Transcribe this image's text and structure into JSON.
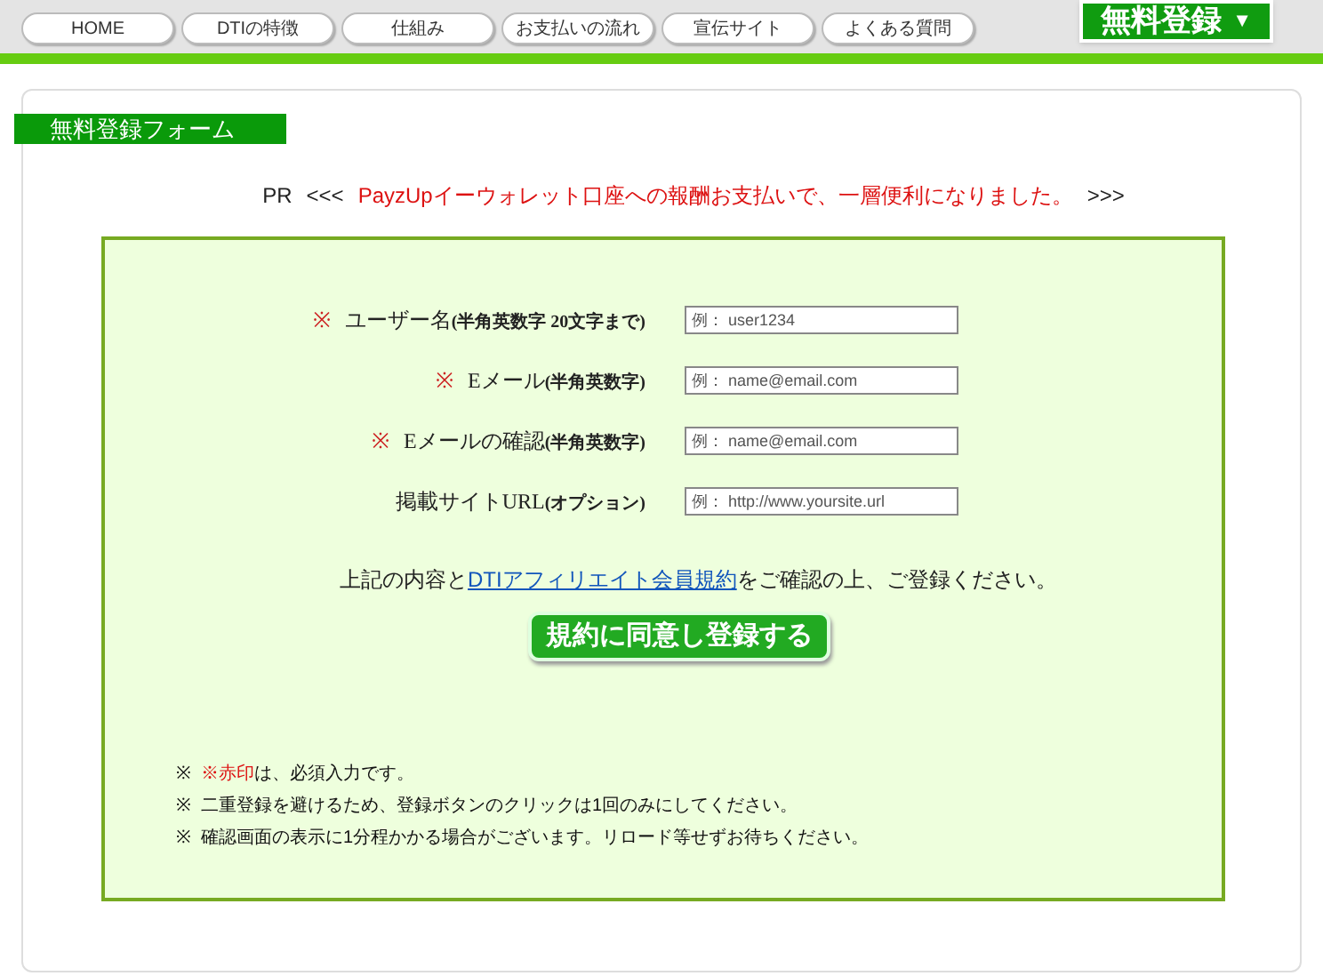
{
  "nav": {
    "items": [
      {
        "label": "HOME"
      },
      {
        "label": "DTIの特徴"
      },
      {
        "label": "仕組み"
      },
      {
        "label": "お支払いの流れ"
      },
      {
        "label": "宣伝サイト"
      },
      {
        "label": "よくある質問"
      }
    ],
    "signup_button": {
      "label": "無料登録",
      "caret": "▼"
    }
  },
  "section_title": "無料登録フォーム",
  "pr": {
    "label": "PR",
    "open": "<<<",
    "text": "PayzUpイーウォレット口座への報酬お支払いで、一層便利になりました。",
    "close": ">>>"
  },
  "fields": [
    {
      "mark": "※",
      "label": "ユーザー名**(半角英数字 20文字まで)**",
      "placeholder": "例： user1234"
    },
    {
      "mark": "※",
      "label": "Eメール**(半角英数字)**",
      "placeholder": "例： name@email.com"
    },
    {
      "mark": "※",
      "label": "Eメールの確認**(半角英数字)**",
      "placeholder": "例： name@email.com"
    },
    {
      "label": "掲載サイトURL**(オプション)**",
      "placeholder": "例： http://www.yoursite.url"
    }
  ],
  "agreement": {
    "before": "上記の内容と",
    "link": "DTIアフィリエイト会員規約",
    "after": "をご確認の上、ご登録ください。"
  },
  "submit_button": "規約に同意し登録する",
  "notes": [
    {
      "bullet": "※",
      "parts": [
        {
          "text": "※赤印",
          "red": true
        },
        {
          "text": "は、必須入力です。",
          "red": false
        }
      ]
    },
    {
      "bullet": "※",
      "parts": [
        {
          "text": "二重登録を避けるため、登録ボタンのクリックは1回のみにしてください。",
          "red": false
        }
      ]
    },
    {
      "bullet": "※",
      "parts": [
        {
          "text": "確認画面の表示に1分程かかる場合がございます。リロード等せずお待ちください。",
          "red": false
        }
      ]
    }
  ]
}
